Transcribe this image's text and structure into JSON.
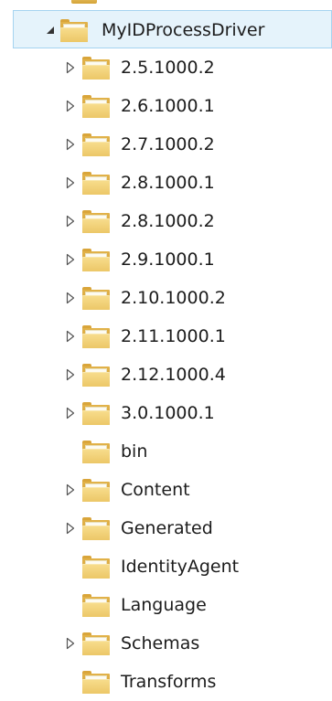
{
  "tree": {
    "root": {
      "label": "MyIDProcessDriver",
      "expanded": true,
      "selected": true,
      "icon": "folder-icon",
      "expander_icon": "expanded-triangle-icon"
    },
    "children": [
      {
        "label": "2.5.1000.2",
        "has_children": true
      },
      {
        "label": "2.6.1000.1",
        "has_children": true
      },
      {
        "label": "2.7.1000.2",
        "has_children": true
      },
      {
        "label": "2.8.1000.1",
        "has_children": true
      },
      {
        "label": "2.8.1000.2",
        "has_children": true
      },
      {
        "label": "2.9.1000.1",
        "has_children": true
      },
      {
        "label": "2.10.1000.2",
        "has_children": true
      },
      {
        "label": "2.11.1000.1",
        "has_children": true
      },
      {
        "label": "2.12.1000.4",
        "has_children": true
      },
      {
        "label": "3.0.1000.1",
        "has_children": true
      },
      {
        "label": "bin",
        "has_children": false
      },
      {
        "label": "Content",
        "has_children": true
      },
      {
        "label": "Generated",
        "has_children": true
      },
      {
        "label": "IdentityAgent",
        "has_children": false
      },
      {
        "label": "Language",
        "has_children": false
      },
      {
        "label": "Schemas",
        "has_children": true
      },
      {
        "label": "Transforms",
        "has_children": false
      }
    ],
    "child_icon": "folder-icon",
    "collapsed_expander_icon": "collapsed-triangle-icon"
  },
  "colors": {
    "selection_background": "#e5f3fb",
    "selection_border": "#a5d3f0",
    "folder_front": "#f2d479",
    "folder_back": "#d9a53a",
    "text": "#1c1c1c"
  }
}
